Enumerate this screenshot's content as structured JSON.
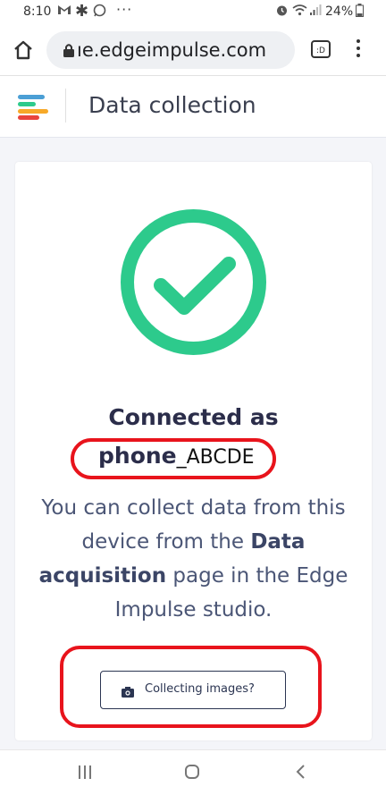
{
  "status_bar": {
    "time": "8:10",
    "left_icons": [
      "gmail-icon",
      "asterisk-icon",
      "whatsapp-icon",
      "more-dots-icon"
    ],
    "right_icons": [
      "alarm-icon",
      "wifi-icon",
      "signal-icon",
      "battery-icon"
    ],
    "battery": "24%"
  },
  "browser": {
    "url": "ıe.edgeimpulse.com",
    "tab_count": ":D"
  },
  "header": {
    "title": "Data collection",
    "logo_colors": [
      "#4b9fd5",
      "#2dca8c",
      "#f7a928",
      "#e9443c"
    ]
  },
  "main": {
    "connected_label": "Connected as",
    "device_name": "phone",
    "device_suffix": "_ABCDE",
    "description_1": "You can collect data from this device from the ",
    "description_bold_1": "Data acquisition",
    "description_2": " page in the Edge Impulse studio.",
    "collect_images_button": "Collecting images?"
  },
  "colors": {
    "success": "#2dca8c",
    "annotation": "#e8141c",
    "text_dark": "#2b2d4a"
  }
}
